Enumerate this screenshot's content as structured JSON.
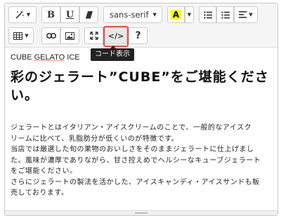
{
  "toolbar": {
    "style_icon": "magic-wand-icon",
    "bold_label": "B",
    "underline_label": "U",
    "eraser_icon": "eraser-icon",
    "font_family": "sans-serif",
    "color_label": "A",
    "highlight_color": "#ffff00",
    "unordered_list_icon": "unordered-list-icon",
    "ordered_list_icon": "ordered-list-icon",
    "align_icon": "align-left-icon",
    "table_icon": "table-icon",
    "link_icon": "link-icon",
    "picture_icon": "picture-icon",
    "fullscreen_icon": "fullscreen-icon",
    "codeview_label": "</>",
    "help_label": "?",
    "codeview_tooltip": "コード表示"
  },
  "content": {
    "small_title_prefix": "CUBE ",
    "small_title_underlined": "GELATO",
    "small_title_suffix": " ICE",
    "heading": "彩のジェラート”CUBE”をご堪能ください。",
    "paragraph_lines": [
      "ジェラートとはイタリアン・アイスクリームのことで、一般的なアイスク",
      "リームに比べて、乳脂肪分が低くいのが特徴です。",
      "当店では厳選した旬の果物のおいしさをそのままジェラートに仕上げまし",
      "た。風味が濃厚でありながら、甘さ控えめでヘルシーなキューブジェラート",
      "をご堪能ください。",
      "さらにジェラートの製法を活かした、アイスキャンディ・アイスサンドも販",
      "売しております。"
    ]
  },
  "colors": {
    "highlight_border": "#e8534a",
    "tooltip_bg": "#222222"
  }
}
